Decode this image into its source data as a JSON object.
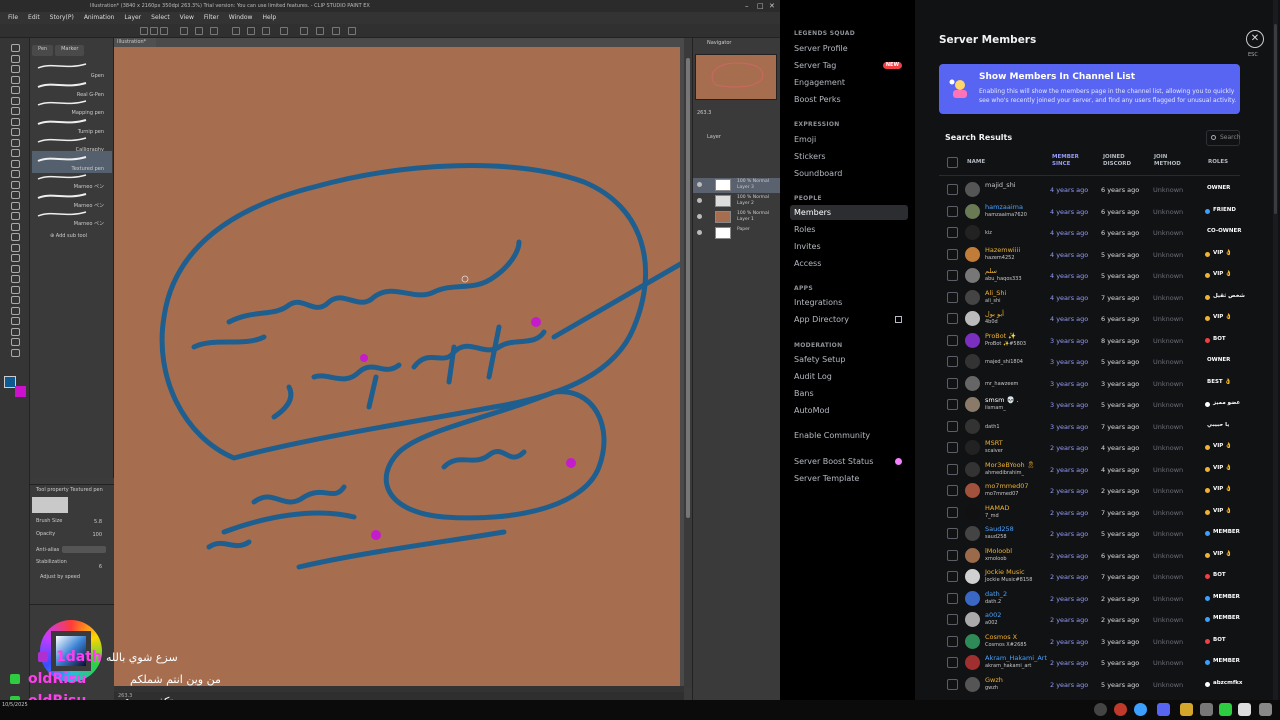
{
  "csp": {
    "title": "Illustration* (3840 x 2160px 350dpi 263.3%)  Trial version: You can use limited features. - CLIP STUDIO PAINT EX",
    "menu": [
      "File",
      "Edit",
      "Story(P)",
      "Animation",
      "Layer",
      "Select",
      "View",
      "Filter",
      "Window",
      "Help"
    ],
    "subtool_tabs": [
      "Pen",
      "Marker"
    ],
    "brushes": [
      "Gpen",
      "Real G-Pen",
      "Mapping pen",
      "Turnip pen",
      "Calligraphy",
      "Textured pen",
      "Marneo ペン",
      "Marneo ペン",
      "Marneo ペン"
    ],
    "add_sub_tool": "Add sub tool",
    "tool_property": {
      "header": "Tool property  Textured pen",
      "brush_size_label": "Brush Size",
      "brush_size_value": "5.8",
      "opacity_label": "Opacity",
      "opacity_value": "100",
      "antialiasing_label": "Anti-alias",
      "stabilization_label": "Stabilization",
      "stabilization_value": "6",
      "adjust_label": "Adjust by speed"
    },
    "canvas_tab": "Illustration*",
    "navigator_tab": "Navigator",
    "nav_zoom": "263.3",
    "layer_tab": "Layer",
    "layers": [
      {
        "title": "100 % Normal",
        "name": "Layer 3"
      },
      {
        "title": "100 % Normal",
        "name": "Layer 2"
      },
      {
        "title": "100 % Normal",
        "name": "Layer 1"
      },
      {
        "title": "",
        "name": "Paper"
      }
    ],
    "status": "263.3"
  },
  "chat": [
    {
      "name": "1dath",
      "message": "سزع شوي بالله",
      "name_color": "#ff3ef0",
      "badge_color": "#b02fd0"
    },
    {
      "name": "oldRisu",
      "message": "من وين انتم شملكم",
      "name_color": "#ff3ef0",
      "badge_color": "#2ecc40"
    },
    {
      "name": "oldRisu",
      "message": "تكفى سرع",
      "name_color": "#ff3ef0",
      "badge_color": "#2ecc40"
    }
  ],
  "discord_nav": {
    "server_label": "LEGENDS SQUAD",
    "items_top": [
      "Server Profile",
      "Server Tag",
      "Engagement",
      "Boost Perks"
    ],
    "new_badge": "NEW",
    "sec_expression": "EXPRESSION",
    "items_expression": [
      "Emoji",
      "Stickers",
      "Soundboard"
    ],
    "sec_people": "PEOPLE",
    "items_people": [
      "Members",
      "Roles",
      "Invites",
      "Access"
    ],
    "sec_apps": "APPS",
    "items_apps": [
      "Integrations",
      "App Directory"
    ],
    "sec_moderation": "MODERATION",
    "items_moderation": [
      "Safety Setup",
      "Audit Log",
      "Bans",
      "AutoMod"
    ],
    "items_bottom": [
      "Enable Community",
      "Server Boost Status",
      "Server Template"
    ]
  },
  "discord_main": {
    "title": "Server Members",
    "esc": "ESC",
    "banner_title": "Show Members In Channel List",
    "banner_desc": "Enabling this will show the members page in the channel list, allowing you to quickly see who's recently joined your server, and find any users flagged for unusual activity.",
    "search_results": "Search Results",
    "search_placeholder": "Search",
    "headers": {
      "name": "NAME",
      "member_since": "MEMBER SINCE",
      "joined_discord": "JOINED DISCORD",
      "join_method": "JOIN METHOD",
      "roles": "ROLES"
    },
    "members": [
      {
        "display": "majid_shi",
        "user": "",
        "since": "4 years ago",
        "joined": "6 years ago",
        "method": "Unknown",
        "role": "OWNER",
        "dot": "",
        "color": "#c8c8c8",
        "av": "#555"
      },
      {
        "display": "hamzaaima",
        "user": "hamzaaima7620",
        "since": "4 years ago",
        "joined": "6 years ago",
        "method": "Unknown",
        "role": "FRIEND",
        "dot": "#3ba0ff",
        "color": "#4aa3ff",
        "av": "#6a7a55"
      },
      {
        "display": "",
        "user": "kiz",
        "since": "4 years ago",
        "joined": "6 years ago",
        "method": "Unknown",
        "role": "CO-OWNER",
        "dot": "",
        "color": "#c8c8c8",
        "av": "#222"
      },
      {
        "display": "Hazemwiiii",
        "user": "hazem4252",
        "since": "4 years ago",
        "joined": "5 years ago",
        "method": "Unknown",
        "role": "VIP 👌",
        "dot": "#f0b232",
        "color": "#f0b232",
        "av": "#c27c3a"
      },
      {
        "display": "سلم",
        "user": "abu_haqos333",
        "since": "4 years ago",
        "joined": "5 years ago",
        "method": "Unknown",
        "role": "VIP 👌",
        "dot": "#f0b232",
        "color": "#f0b232",
        "av": "#777"
      },
      {
        "display": "Ali_Shi",
        "user": "ali_shi",
        "since": "4 years ago",
        "joined": "7 years ago",
        "method": "Unknown",
        "role": "شخص ثقيل",
        "dot": "#f0b232",
        "color": "#f0b232",
        "av": "#444"
      },
      {
        "display": "أبو بول",
        "user": "4b0d",
        "since": "4 years ago",
        "joined": "6 years ago",
        "method": "Unknown",
        "role": "VIP 👌",
        "dot": "#f0b232",
        "color": "#f0b232",
        "av": "#bbb"
      },
      {
        "display": "ProBot ✨",
        "user": "ProBot ✨#5803",
        "since": "3 years ago",
        "joined": "8 years ago",
        "method": "Unknown",
        "role": "BOT",
        "dot": "#f23f43",
        "color": "#f0b232",
        "av": "#7b2fbe"
      },
      {
        "display": "",
        "user": "majed_shi1804",
        "since": "3 years ago",
        "joined": "5 years ago",
        "method": "Unknown",
        "role": "OWNER",
        "dot": "",
        "color": "#c8c8c8",
        "av": "#333"
      },
      {
        "display": "",
        "user": "mr_hawzeem",
        "since": "3 years ago",
        "joined": "3 years ago",
        "method": "Unknown",
        "role": "BEST 👌",
        "dot": "",
        "color": "#c8c8c8",
        "av": "#666"
      },
      {
        "display": "smsm 💀 .",
        "user": "iismam_",
        "since": "3 years ago",
        "joined": "5 years ago",
        "method": "Unknown",
        "role": "عضو مميز",
        "dot": "#ffffff",
        "color": "#ffffff",
        "av": "#8a7a6a"
      },
      {
        "display": "",
        "user": "dath1",
        "since": "3 years ago",
        "joined": "7 years ago",
        "method": "Unknown",
        "role": "يا حبيبي",
        "dot": "",
        "color": "#c8c8c8",
        "av": "#333"
      },
      {
        "display": "MSRT",
        "user": "scaiver",
        "since": "2 years ago",
        "joined": "4 years ago",
        "method": "Unknown",
        "role": "VIP 👌",
        "dot": "#f0b232",
        "color": "#f0b232",
        "av": "#222"
      },
      {
        "display": "Mor3eBYooh 🎗",
        "user": "ahmedibrahim_",
        "since": "2 years ago",
        "joined": "4 years ago",
        "method": "Unknown",
        "role": "VIP 👌",
        "dot": "#f0b232",
        "color": "#f0b232",
        "av": "#333"
      },
      {
        "display": "mo7mmed07",
        "user": "mo7mmed07",
        "since": "2 years ago",
        "joined": "2 years ago",
        "method": "Unknown",
        "role": "VIP 👌",
        "dot": "#f0b232",
        "color": "#f0b232",
        "av": "#a0523d"
      },
      {
        "display": "HAMAD",
        "user": "7_md",
        "since": "2 years ago",
        "joined": "7 years ago",
        "method": "Unknown",
        "role": "VIP 👌",
        "dot": "#f0b232",
        "color": "#f0b232",
        "av": "#111"
      },
      {
        "display": "Saud258",
        "user": "saud258",
        "since": "2 years ago",
        "joined": "5 years ago",
        "method": "Unknown",
        "role": "MEMBER",
        "dot": "#3ba0ff",
        "color": "#4aa3ff",
        "av": "#444"
      },
      {
        "display": "lMoloobl",
        "user": "xmoloob",
        "since": "2 years ago",
        "joined": "6 years ago",
        "method": "Unknown",
        "role": "VIP 👌",
        "dot": "#f0b232",
        "color": "#f0b232",
        "av": "#9a6a4a"
      },
      {
        "display": "Jockie Music",
        "user": "Jockie Music#8158",
        "since": "2 years ago",
        "joined": "7 years ago",
        "method": "Unknown",
        "role": "BOT",
        "dot": "#f23f43",
        "color": "#f0b232",
        "av": "#d0d0d0"
      },
      {
        "display": "dath_2",
        "user": "dath.2",
        "since": "2 years ago",
        "joined": "2 years ago",
        "method": "Unknown",
        "role": "MEMBER",
        "dot": "#3ba0ff",
        "color": "#4aa3ff",
        "av": "#3a66c4"
      },
      {
        "display": "a002",
        "user": "a002",
        "since": "2 years ago",
        "joined": "2 years ago",
        "method": "Unknown",
        "role": "MEMBER",
        "dot": "#3ba0ff",
        "color": "#4aa3ff",
        "av": "#aaa"
      },
      {
        "display": "Cosmos X",
        "user": "Cosmos X#2685",
        "since": "2 years ago",
        "joined": "3 years ago",
        "method": "Unknown",
        "role": "BOT",
        "dot": "#f23f43",
        "color": "#f0b232",
        "av": "#2e8b57"
      },
      {
        "display": "Akram_Hakami_Art",
        "user": "akram_hakami_art",
        "since": "2 years ago",
        "joined": "5 years ago",
        "method": "Unknown",
        "role": "MEMBER",
        "dot": "#3ba0ff",
        "color": "#4aa3ff",
        "av": "#a03030"
      },
      {
        "display": "Gwzh",
        "user": "gwzh",
        "since": "2 years ago",
        "joined": "5 years ago",
        "method": "Unknown",
        "role": "abzcmfkx",
        "dot": "#ffffff",
        "color": "#f0b232",
        "av": "#555"
      }
    ]
  },
  "taskbar": {
    "date": "10/5/2025"
  }
}
